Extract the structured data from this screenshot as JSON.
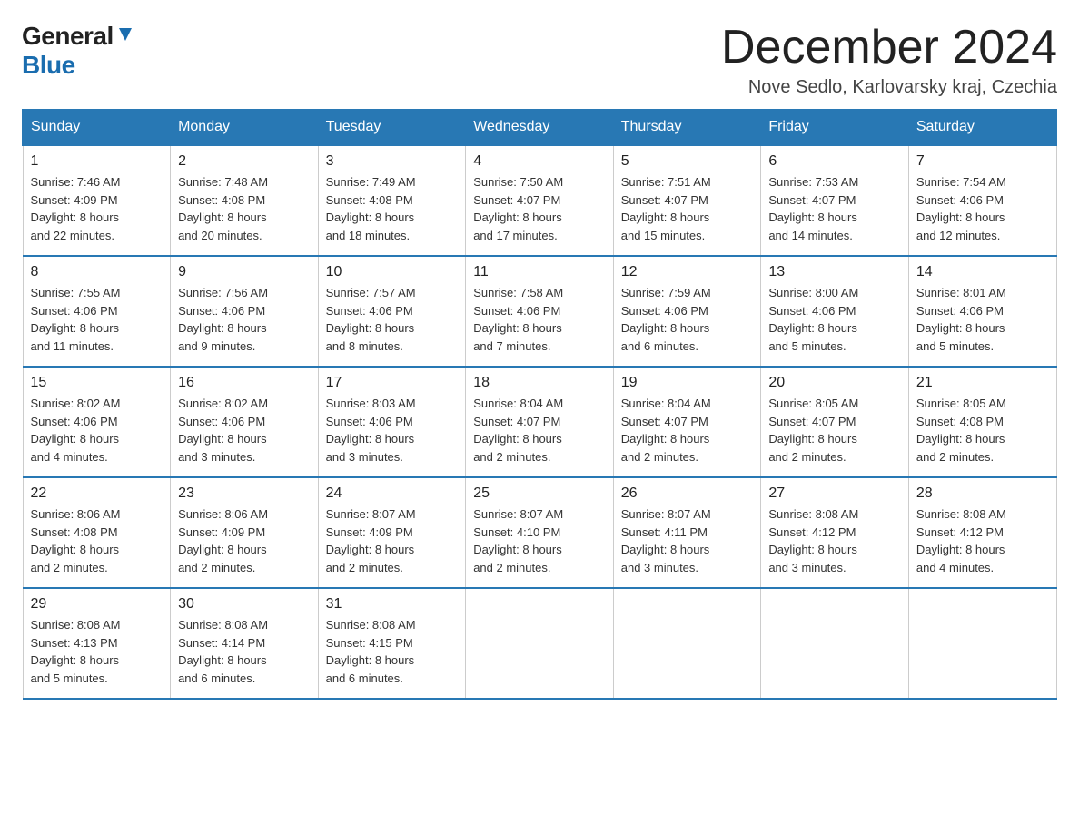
{
  "header": {
    "logo_general": "General",
    "logo_blue": "Blue",
    "month_title": "December 2024",
    "location": "Nove Sedlo, Karlovarsky kraj, Czechia"
  },
  "days_of_week": [
    "Sunday",
    "Monday",
    "Tuesday",
    "Wednesday",
    "Thursday",
    "Friday",
    "Saturday"
  ],
  "weeks": [
    [
      {
        "day": "1",
        "sunrise": "7:46 AM",
        "sunset": "4:09 PM",
        "daylight": "8 hours and 22 minutes."
      },
      {
        "day": "2",
        "sunrise": "7:48 AM",
        "sunset": "4:08 PM",
        "daylight": "8 hours and 20 minutes."
      },
      {
        "day": "3",
        "sunrise": "7:49 AM",
        "sunset": "4:08 PM",
        "daylight": "8 hours and 18 minutes."
      },
      {
        "day": "4",
        "sunrise": "7:50 AM",
        "sunset": "4:07 PM",
        "daylight": "8 hours and 17 minutes."
      },
      {
        "day": "5",
        "sunrise": "7:51 AM",
        "sunset": "4:07 PM",
        "daylight": "8 hours and 15 minutes."
      },
      {
        "day": "6",
        "sunrise": "7:53 AM",
        "sunset": "4:07 PM",
        "daylight": "8 hours and 14 minutes."
      },
      {
        "day": "7",
        "sunrise": "7:54 AM",
        "sunset": "4:06 PM",
        "daylight": "8 hours and 12 minutes."
      }
    ],
    [
      {
        "day": "8",
        "sunrise": "7:55 AM",
        "sunset": "4:06 PM",
        "daylight": "8 hours and 11 minutes."
      },
      {
        "day": "9",
        "sunrise": "7:56 AM",
        "sunset": "4:06 PM",
        "daylight": "8 hours and 9 minutes."
      },
      {
        "day": "10",
        "sunrise": "7:57 AM",
        "sunset": "4:06 PM",
        "daylight": "8 hours and 8 minutes."
      },
      {
        "day": "11",
        "sunrise": "7:58 AM",
        "sunset": "4:06 PM",
        "daylight": "8 hours and 7 minutes."
      },
      {
        "day": "12",
        "sunrise": "7:59 AM",
        "sunset": "4:06 PM",
        "daylight": "8 hours and 6 minutes."
      },
      {
        "day": "13",
        "sunrise": "8:00 AM",
        "sunset": "4:06 PM",
        "daylight": "8 hours and 5 minutes."
      },
      {
        "day": "14",
        "sunrise": "8:01 AM",
        "sunset": "4:06 PM",
        "daylight": "8 hours and 5 minutes."
      }
    ],
    [
      {
        "day": "15",
        "sunrise": "8:02 AM",
        "sunset": "4:06 PM",
        "daylight": "8 hours and 4 minutes."
      },
      {
        "day": "16",
        "sunrise": "8:02 AM",
        "sunset": "4:06 PM",
        "daylight": "8 hours and 3 minutes."
      },
      {
        "day": "17",
        "sunrise": "8:03 AM",
        "sunset": "4:06 PM",
        "daylight": "8 hours and 3 minutes."
      },
      {
        "day": "18",
        "sunrise": "8:04 AM",
        "sunset": "4:07 PM",
        "daylight": "8 hours and 2 minutes."
      },
      {
        "day": "19",
        "sunrise": "8:04 AM",
        "sunset": "4:07 PM",
        "daylight": "8 hours and 2 minutes."
      },
      {
        "day": "20",
        "sunrise": "8:05 AM",
        "sunset": "4:07 PM",
        "daylight": "8 hours and 2 minutes."
      },
      {
        "day": "21",
        "sunrise": "8:05 AM",
        "sunset": "4:08 PM",
        "daylight": "8 hours and 2 minutes."
      }
    ],
    [
      {
        "day": "22",
        "sunrise": "8:06 AM",
        "sunset": "4:08 PM",
        "daylight": "8 hours and 2 minutes."
      },
      {
        "day": "23",
        "sunrise": "8:06 AM",
        "sunset": "4:09 PM",
        "daylight": "8 hours and 2 minutes."
      },
      {
        "day": "24",
        "sunrise": "8:07 AM",
        "sunset": "4:09 PM",
        "daylight": "8 hours and 2 minutes."
      },
      {
        "day": "25",
        "sunrise": "8:07 AM",
        "sunset": "4:10 PM",
        "daylight": "8 hours and 2 minutes."
      },
      {
        "day": "26",
        "sunrise": "8:07 AM",
        "sunset": "4:11 PM",
        "daylight": "8 hours and 3 minutes."
      },
      {
        "day": "27",
        "sunrise": "8:08 AM",
        "sunset": "4:12 PM",
        "daylight": "8 hours and 3 minutes."
      },
      {
        "day": "28",
        "sunrise": "8:08 AM",
        "sunset": "4:12 PM",
        "daylight": "8 hours and 4 minutes."
      }
    ],
    [
      {
        "day": "29",
        "sunrise": "8:08 AM",
        "sunset": "4:13 PM",
        "daylight": "8 hours and 5 minutes."
      },
      {
        "day": "30",
        "sunrise": "8:08 AM",
        "sunset": "4:14 PM",
        "daylight": "8 hours and 6 minutes."
      },
      {
        "day": "31",
        "sunrise": "8:08 AM",
        "sunset": "4:15 PM",
        "daylight": "8 hours and 6 minutes."
      },
      null,
      null,
      null,
      null
    ]
  ],
  "labels": {
    "sunrise": "Sunrise:",
    "sunset": "Sunset:",
    "daylight": "Daylight:"
  }
}
